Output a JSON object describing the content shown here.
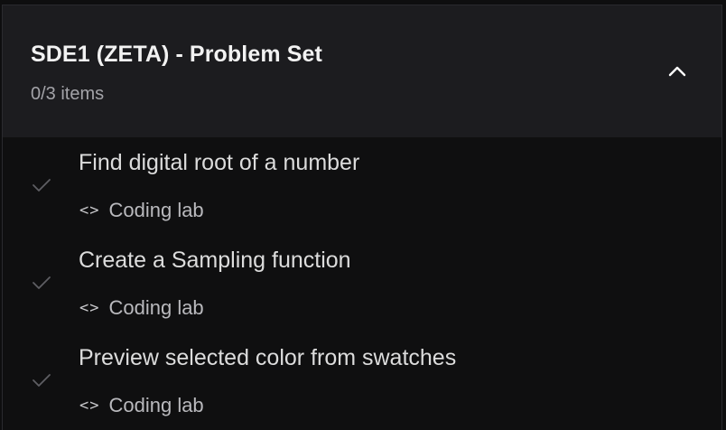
{
  "section": {
    "title": "SDE1 (ZETA) - Problem Set",
    "count": "0/3 items",
    "collapse_icon": "chevron-up-icon"
  },
  "items": [
    {
      "title": "Find digital root of a number",
      "type": "Coding lab",
      "type_icon": "code-icon",
      "status_icon": "check-icon"
    },
    {
      "title": "Create a Sampling function",
      "type": "Coding lab",
      "type_icon": "code-icon",
      "status_icon": "check-icon"
    },
    {
      "title": "Preview selected color from swatches",
      "type": "Coding lab",
      "type_icon": "code-icon",
      "status_icon": "check-icon"
    }
  ],
  "colors": {
    "header_bg": "#1c1c1f",
    "list_bg": "#0f0f10",
    "check": "#5e5e63"
  }
}
